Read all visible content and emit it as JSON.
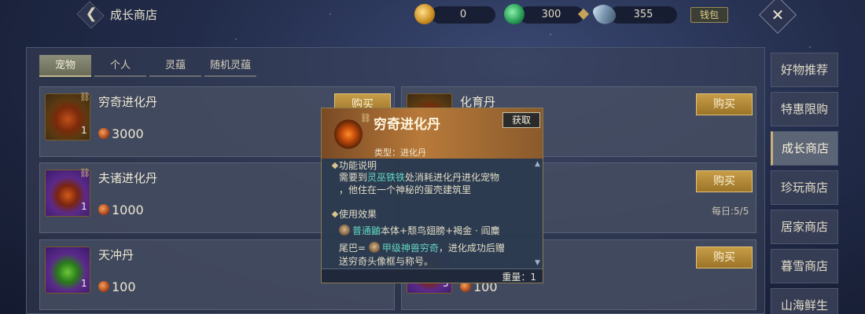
{
  "header": {
    "title": "成长商店",
    "back_icon": "back-chevron-icon",
    "close_icon": "close-icon"
  },
  "currencies": [
    {
      "icon": "gold-coin-icon",
      "value": "0"
    },
    {
      "icon": "jade-coin-icon",
      "value": "300"
    },
    {
      "icon": "crystal-icon",
      "value": "355"
    }
  ],
  "wallet_label": "钱包",
  "tabs": [
    {
      "label": "宠物",
      "active": true
    },
    {
      "label": "个人",
      "active": false
    },
    {
      "label": "灵蕴",
      "active": false
    },
    {
      "label": "随机灵蕴",
      "active": false
    }
  ],
  "items": [
    {
      "name": "穷奇进化丹",
      "count": "1",
      "price": "3000",
      "buy_label": "购买"
    },
    {
      "name": "化育丹",
      "buy_label": "购买"
    },
    {
      "name": "夫诸进化丹",
      "count": "1",
      "price": "1000"
    },
    {
      "buy_label": "购买",
      "daily_limit": "每日:5/5"
    },
    {
      "name": "天冲丹",
      "count": "1",
      "price": "100"
    },
    {
      "count": "5",
      "price": "100",
      "buy_label": "购买"
    }
  ],
  "categories": [
    {
      "label": "好物推荐",
      "active": false
    },
    {
      "label": "特惠限购",
      "active": false
    },
    {
      "label": "成长商店",
      "active": true
    },
    {
      "label": "珍玩商店",
      "active": false
    },
    {
      "label": "居家商店",
      "active": false
    },
    {
      "label": "暮雪商店",
      "active": false
    },
    {
      "label": "山海鲜生",
      "active": false
    }
  ],
  "tooltip": {
    "title": "穷奇进化丹",
    "type": "类型：进化丹",
    "acquire_label": "获取",
    "section1_title": "功能说明",
    "section1_line1_pre": "需要到",
    "section1_line1_link": "灵巫铁铁",
    "section1_line1_post": "处消耗进化丹进化宠物",
    "section1_line2": "，他住在一个神秘的蛋壳建筑里",
    "section2_title": "使用效果",
    "section2_line1_link": "普通鼬",
    "section2_line1_post": "本体+颓鸟翅膀+褐金 · 阎麋",
    "section2_line2_pre": "尾巴= ",
    "section2_line2_link": "甲级神兽穷奇",
    "section2_line2_post": "，进化成功后赠",
    "section2_line3": "送穷奇头像框与称号。",
    "weight": "重量：1"
  }
}
